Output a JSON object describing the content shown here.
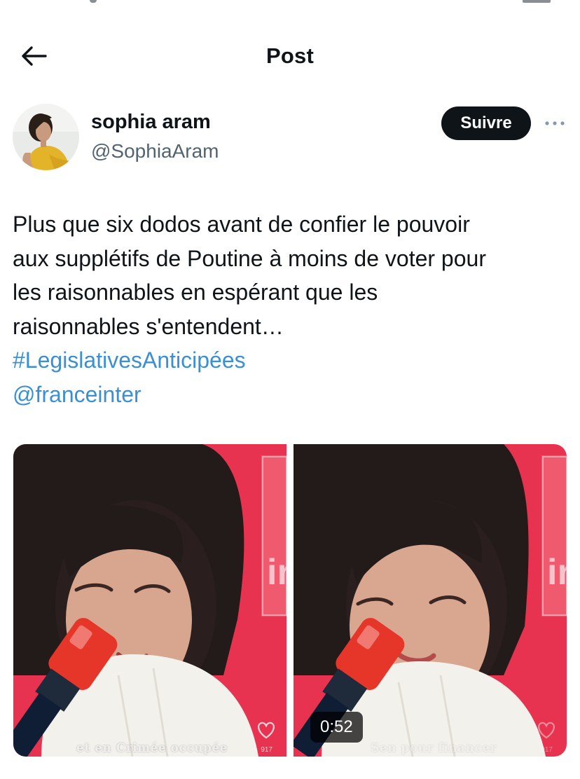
{
  "header": {
    "title": "Post",
    "back_icon": "arrow-left-icon"
  },
  "author": {
    "name": "sophia aram",
    "handle": "@SophiaAram",
    "follow_label": "Suivre",
    "more_icon": "more-dots-icon"
  },
  "post": {
    "lines": [
      "Plus que six dodos avant de confier le pouvoir",
      "aux supplétifs de Poutine à moins de voter pour",
      "les raisonnables en espérant que les",
      "raisonnables s'entendent…"
    ],
    "hashtag": "#LegislativesAnticipées",
    "mention": "@franceinter"
  },
  "media": {
    "items": [
      {
        "caption": "et en Crimée occupée",
        "likes": "917"
      },
      {
        "caption": "Sen pour financer",
        "likes": "917",
        "duration": "0:52"
      }
    ]
  },
  "colors": {
    "link": "#3b8fd3",
    "follow_bg": "#0f1419",
    "studio_red": "#e8304e"
  }
}
